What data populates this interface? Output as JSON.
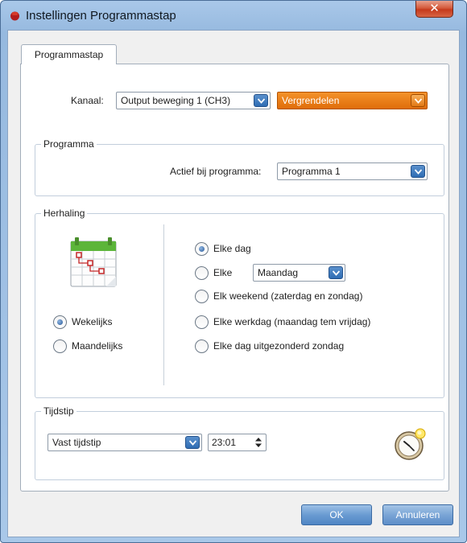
{
  "window": {
    "title": "Instellingen Programmastap",
    "close_label": "✕"
  },
  "tabs": [
    {
      "label": "Programmastap"
    }
  ],
  "kanaal": {
    "label": "Kanaal:",
    "value": "Output beweging 1 (CH3)",
    "action_value": "Vergrendelen"
  },
  "programma": {
    "group_title": "Programma",
    "label": "Actief bij programma:",
    "value": "Programma 1"
  },
  "herhaling": {
    "group_title": "Herhaling",
    "period": [
      {
        "label": "Wekelijks",
        "checked": true
      },
      {
        "label": "Maandelijks",
        "checked": false
      }
    ],
    "options": [
      {
        "label": "Elke dag",
        "checked": true
      },
      {
        "label": "Elke",
        "checked": false
      },
      {
        "label": "Elk weekend (zaterdag en zondag)",
        "checked": false
      },
      {
        "label": "Elke werkdag (maandag tem vrijdag)",
        "checked": false
      },
      {
        "label": "Elke dag uitgezonderd zondag",
        "checked": false
      }
    ],
    "day_value": "Maandag",
    "icon": "calendar-icon"
  },
  "tijdstip": {
    "group_title": "Tijdstip",
    "type_value": "Vast tijdstip",
    "time_value": "23:01",
    "icon": "clock-icon"
  },
  "buttons": {
    "ok_label": "OK",
    "cancel_label": "Annuleren"
  },
  "colors": {
    "accent": "#2f6db4",
    "orange": "#e06d0a",
    "close": "#c53a1c"
  }
}
